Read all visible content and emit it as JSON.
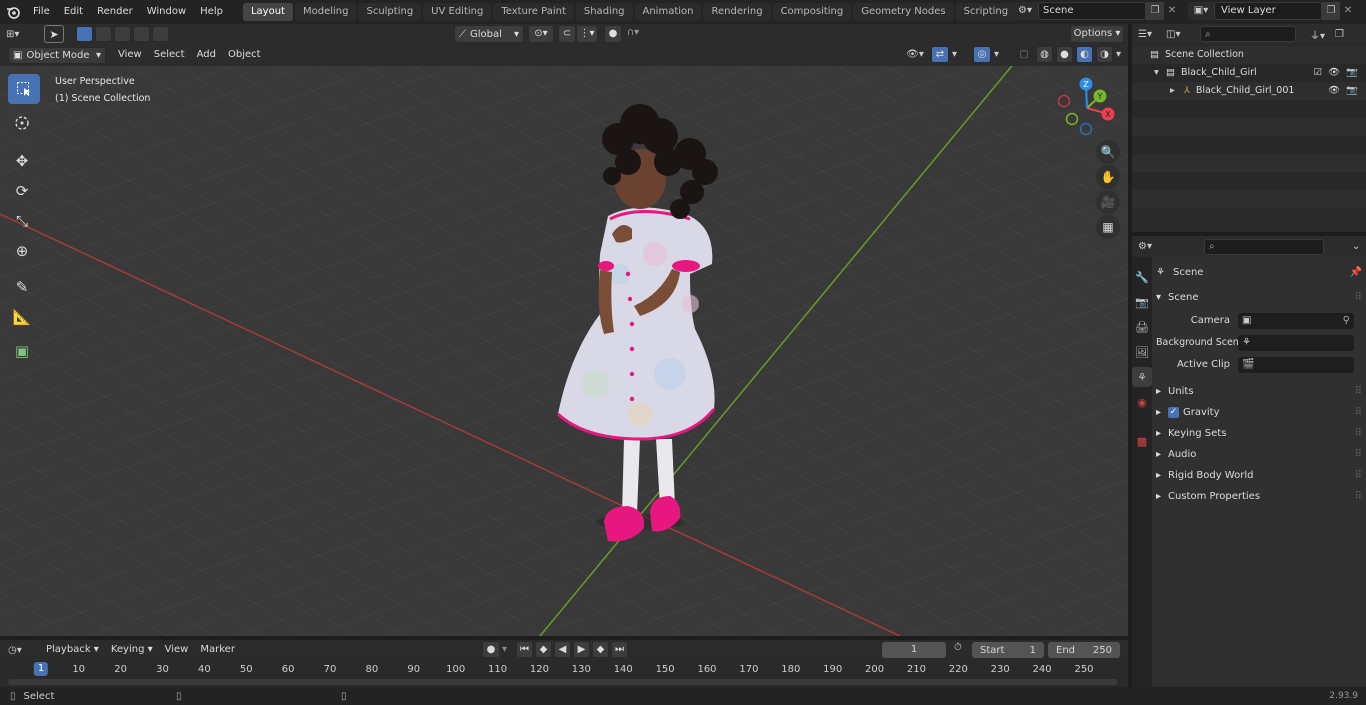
{
  "menu": {
    "items": [
      "File",
      "Edit",
      "Render",
      "Window",
      "Help"
    ]
  },
  "workspaces": {
    "tabs": [
      "Layout",
      "Modeling",
      "Sculpting",
      "UV Editing",
      "Texture Paint",
      "Shading",
      "Animation",
      "Rendering",
      "Compositing",
      "Geometry Nodes",
      "Scripting"
    ],
    "add_label": "+"
  },
  "scene_selector": {
    "value": "Scene"
  },
  "view_layer_selector": {
    "value": "View Layer"
  },
  "viewport_header": {
    "mode": "Object Mode",
    "menus": [
      "View",
      "Select",
      "Add",
      "Object"
    ],
    "transform_orientation": "Global",
    "options_label": "Options"
  },
  "viewport": {
    "overlay_line1": "User Perspective",
    "overlay_line2": "(1) Scene Collection",
    "gizmo_axes": {
      "z": "Z",
      "y": "Y",
      "x": "X"
    }
  },
  "toolbar": {
    "tools": [
      "select-box-icon",
      "cursor-icon",
      "move-icon",
      "rotate-icon",
      "scale-icon",
      "transform-icon",
      "annotate-icon",
      "measure-icon",
      "add-cube-icon"
    ]
  },
  "outliner": {
    "search_placeholder": "",
    "rows": [
      {
        "label": "Scene Collection",
        "indent": 0,
        "icon": "collection-icon"
      },
      {
        "label": "Black_Child_Girl",
        "indent": 1,
        "icon": "collection-icon"
      },
      {
        "label": "Black_Child_Girl_001",
        "indent": 2,
        "icon": "armature-icon"
      }
    ]
  },
  "properties": {
    "breadcrumb": "Scene",
    "section_title": "Scene",
    "fields": [
      {
        "label": "Camera",
        "value": ""
      },
      {
        "label": "Background Scene",
        "value": ""
      },
      {
        "label": "Active Clip",
        "value": ""
      }
    ],
    "panels": [
      "Units",
      "Gravity",
      "Keying Sets",
      "Audio",
      "Rigid Body World",
      "Custom Properties"
    ],
    "gravity_checked": true
  },
  "timeline_header": {
    "menus": [
      "Playback",
      "Keying",
      "View",
      "Marker"
    ],
    "current_frame": "1",
    "start_label": "Start",
    "start_value": "1",
    "end_label": "End",
    "end_value": "250"
  },
  "timeline": {
    "ticks": [
      "1",
      "10",
      "20",
      "30",
      "40",
      "50",
      "60",
      "70",
      "80",
      "90",
      "100",
      "110",
      "120",
      "130",
      "140",
      "150",
      "160",
      "170",
      "180",
      "190",
      "200",
      "210",
      "220",
      "230",
      "240",
      "250"
    ]
  },
  "statusbar": {
    "left_label": "Select",
    "version": "2.93.9"
  },
  "colors": {
    "accent": "#4772b3",
    "x_axis": "#b33b3b",
    "y_axis": "#6a9a2a",
    "gizmo_x": "#f03e4d",
    "gizmo_y": "#76b82a",
    "gizmo_z": "#2c8fe6",
    "dress_pink": "#e6187f"
  }
}
